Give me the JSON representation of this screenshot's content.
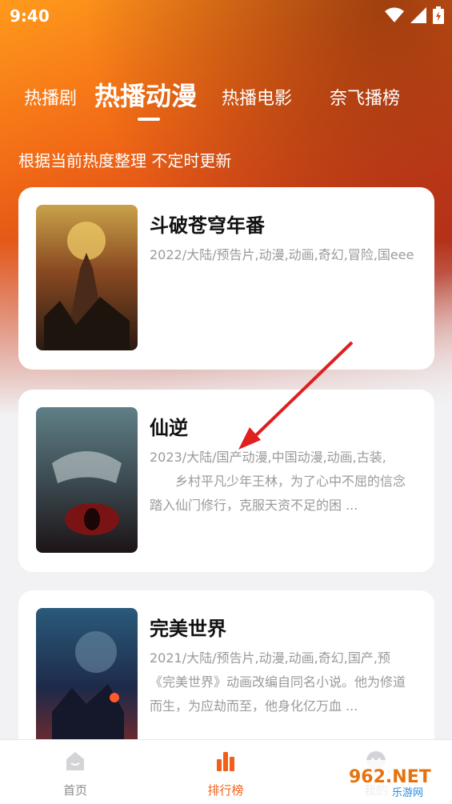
{
  "status_bar": {
    "time": "9:40"
  },
  "tabs": [
    {
      "label": "热播剧",
      "active": false
    },
    {
      "label": "热播动漫",
      "active": true
    },
    {
      "label": "热播电影",
      "active": false
    },
    {
      "label": "奈飞播榜",
      "active": false
    }
  ],
  "subtitle": "根据当前热度整理 不定时更新",
  "cards": [
    {
      "title": "斗破苍穹年番",
      "meta": "2022/大陆/预告片,动漫,动画,奇幻,冒险,国eee",
      "desc": ""
    },
    {
      "title": "仙逆",
      "meta": "2023/大陆/国产动漫,中国动漫,动画,古装,",
      "desc": "　　乡村平凡少年王林，为了心中不屈的信念踏入仙门修行，克服天资不足的困 ..."
    },
    {
      "title": "完美世界",
      "meta": "2021/大陆/预告片,动漫,动画,奇幻,国产,预",
      "desc": "《完美世界》动画改编自同名小说。他为修道而生，为应劫而至，他身化亿万血 ..."
    }
  ],
  "bottom_nav": [
    {
      "label": "首页",
      "active": false
    },
    {
      "label": "排行榜",
      "active": true
    },
    {
      "label": "我的",
      "active": false
    }
  ],
  "watermark": {
    "brand": "962.NET",
    "sub": "乐游网"
  },
  "colors": {
    "accent": "#f0601a",
    "hero_orange": "#f26a16",
    "hero_red": "#b8301c",
    "annotation_arrow": "#e01f1f"
  }
}
